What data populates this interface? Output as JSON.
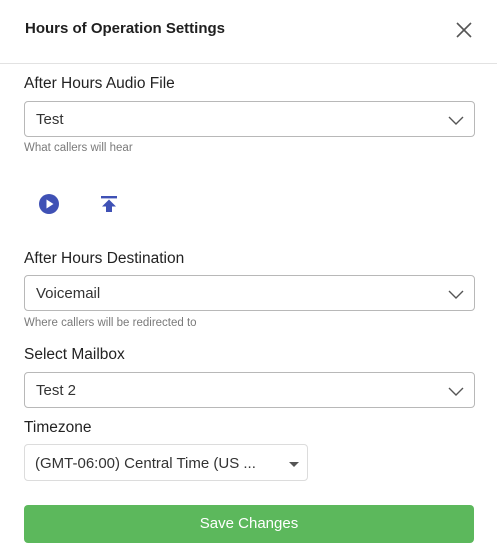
{
  "dialog": {
    "title": "Hours of Operation Settings"
  },
  "audio_file": {
    "label": "After Hours Audio File",
    "value": "Test",
    "helper": "What callers will hear"
  },
  "icons": {
    "play": "play-icon",
    "upload": "upload-icon",
    "close": "close-icon"
  },
  "destination": {
    "label": "After Hours Destination",
    "value": "Voicemail",
    "helper": "Where callers will be redirected to"
  },
  "mailbox": {
    "label": "Select Mailbox",
    "value": "Test 2"
  },
  "timezone": {
    "label": "Timezone",
    "value": "(GMT-06:00) Central Time (US ..."
  },
  "actions": {
    "save_label": "Save Changes"
  },
  "colors": {
    "accent_blue": "#3f51b5",
    "save_green": "#5cb85c"
  }
}
